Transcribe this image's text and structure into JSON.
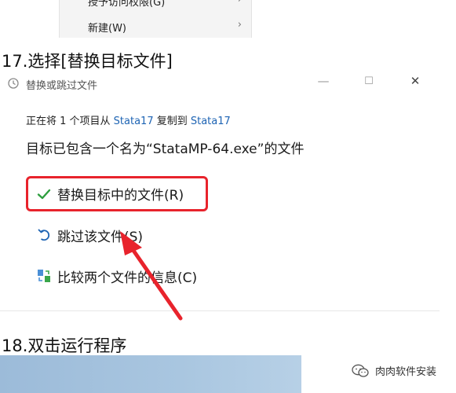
{
  "context_menu": {
    "items": [
      {
        "label": "授予访问权限(G)",
        "arrow": "›"
      },
      {
        "label": "新建(W)",
        "arrow": "›"
      }
    ]
  },
  "steps": {
    "step17": "17.选择[替换目标文件]",
    "step18": "18.双击运行程序"
  },
  "dialog": {
    "title": "替换或跳过文件",
    "controls": {
      "minimize": "—",
      "maximize": "☐",
      "close": "✕"
    },
    "status": {
      "prefix": "正在将 1 个项目从 ",
      "source": "Stata17",
      "middle": " 复制到 ",
      "dest": "Stata17"
    },
    "message": "目标已包含一个名为“StataMP-64.exe”的文件",
    "options": [
      {
        "label": "替换目标中的文件(R)",
        "icon": "checkmark-icon"
      },
      {
        "label": "跳过该文件(S)",
        "icon": "undo-icon"
      },
      {
        "label": "比较两个文件的信息(C)",
        "icon": "compare-icon"
      }
    ]
  },
  "watermark": {
    "text": "肉肉软件安装"
  },
  "colors": {
    "highlight_border": "#e8232c",
    "annotation_arrow": "#e8232c",
    "link": "#1e64b4",
    "check": "#2e9e3e"
  }
}
